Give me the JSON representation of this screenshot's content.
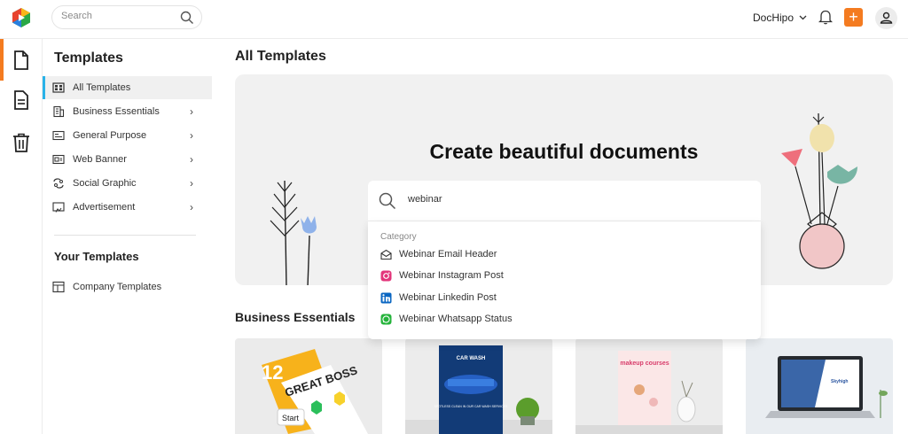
{
  "topbar": {
    "search_placeholder": "Search",
    "account_label": "DocHipo",
    "plus_label": "+",
    "brand_colors": {
      "accent": "#f47b20",
      "active_tab": "#29b2e8"
    }
  },
  "sidebar": {
    "title": "Templates",
    "items": [
      {
        "label": "All Templates",
        "icon": "grid-icon",
        "chevron": ""
      },
      {
        "label": "Business Essentials",
        "icon": "building-icon",
        "chevron": "›"
      },
      {
        "label": "General Purpose",
        "icon": "general-icon",
        "chevron": "›"
      },
      {
        "label": "Web Banner",
        "icon": "banner-icon",
        "chevron": "›"
      },
      {
        "label": "Social Graphic",
        "icon": "social-icon",
        "chevron": "›"
      },
      {
        "label": "Advertisement",
        "icon": "ad-icon",
        "chevron": "›"
      }
    ],
    "your_templates_title": "Your Templates",
    "company_templates": {
      "label": "Company Templates",
      "icon": "company-icon"
    }
  },
  "main": {
    "title": "All Templates",
    "hero": {
      "title": "Create beautiful documents"
    },
    "search": {
      "value": "webinar"
    },
    "dropdown": {
      "category_label": "Category",
      "items": [
        {
          "label": "Webinar Email Header",
          "icon": "email-icon"
        },
        {
          "label": "Webinar Instagram Post",
          "icon": "instagram-icon"
        },
        {
          "label": "Webinar Linkedin Post",
          "icon": "linkedin-icon"
        },
        {
          "label": "Webinar Whatsapp Status",
          "icon": "whatsapp-icon"
        }
      ]
    },
    "section_title": "Business Essentials",
    "cards": [
      {
        "big_number": "12",
        "headline": "GREAT BOSS",
        "tag": "Start"
      },
      {
        "headline": "CAR WASH",
        "sub": "SPOTLESS CLEAN IN OUR CAR WASH SERVICES"
      },
      {
        "headline": "makeup courses"
      },
      {
        "headline": "Skyhigh"
      }
    ]
  }
}
